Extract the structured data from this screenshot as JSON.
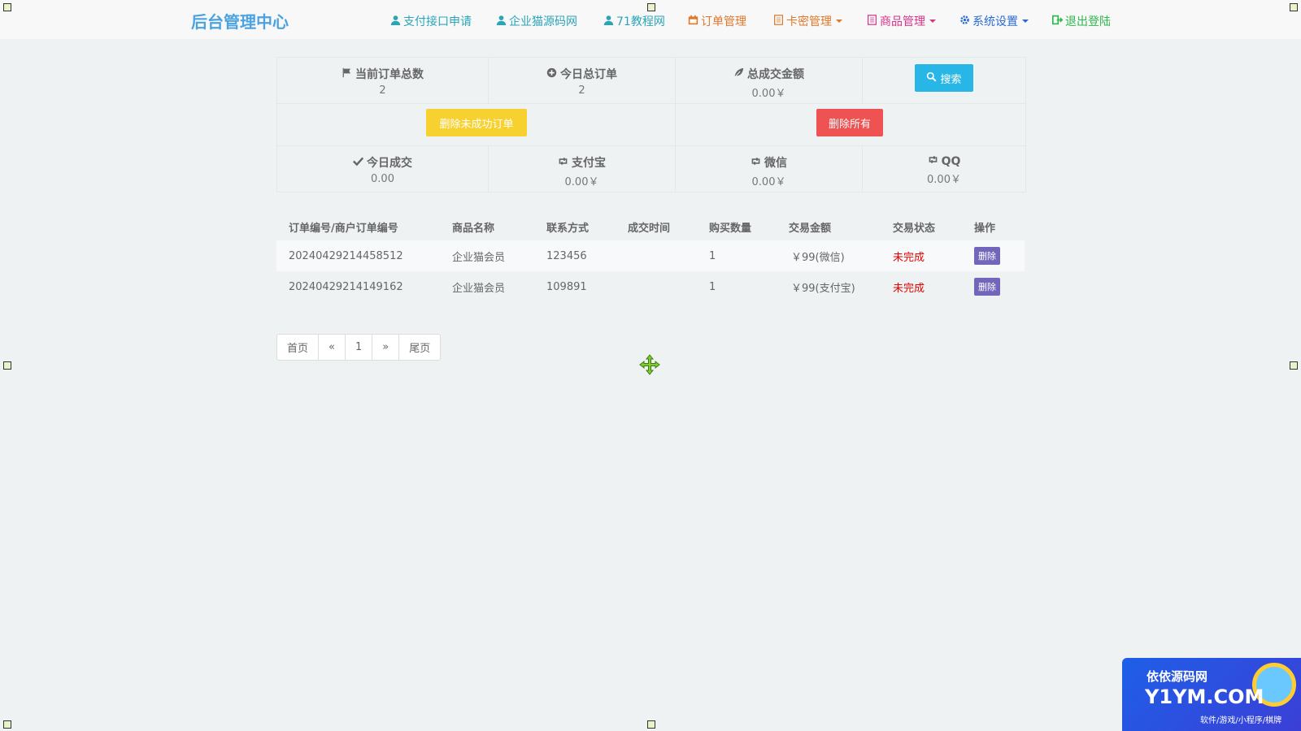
{
  "navbar": {
    "brand": "后台管理中心",
    "items": [
      {
        "label": "支付接口申请",
        "icon": "user-icon",
        "color": "#2aa5b8",
        "dropdown": false
      },
      {
        "label": "企业猫源码网",
        "icon": "user-icon",
        "color": "#2aa5b8",
        "dropdown": false
      },
      {
        "label": "71教程网",
        "icon": "user-icon",
        "color": "#2aa5b8",
        "dropdown": false
      },
      {
        "label": "订单管理",
        "icon": "calendar-icon",
        "color": "#e0782b",
        "dropdown": false
      },
      {
        "label": "卡密管理",
        "icon": "list-icon",
        "color": "#e0782b",
        "dropdown": true
      },
      {
        "label": "商品管理",
        "icon": "list-icon",
        "color": "#d6338a",
        "dropdown": true
      },
      {
        "label": "系统设置",
        "icon": "gear-icon",
        "color": "#2a6bd1",
        "dropdown": true
      },
      {
        "label": "退出登陆",
        "icon": "logout-icon",
        "color": "#2bb84a",
        "dropdown": false
      }
    ]
  },
  "stats": {
    "current_total": {
      "label": "当前订单总数",
      "value": "2",
      "icon": "flag-icon"
    },
    "today_orders": {
      "label": "今日总订单",
      "value": "2",
      "icon": "plus-circle-icon"
    },
    "total_amount": {
      "label": "总成交金额",
      "value": "0.00￥",
      "icon": "leaf-icon"
    },
    "search_button": "搜索",
    "delete_failed_button": "删除未成功订单",
    "delete_all_button": "删除所有",
    "today_deal": {
      "label": "今日成交",
      "value": "0.00",
      "icon": "check-icon"
    },
    "alipay": {
      "label": "支付宝",
      "value": "0.00￥",
      "icon": "retweet-icon"
    },
    "wechat": {
      "label": "微信",
      "value": "0.00￥",
      "icon": "retweet-icon"
    },
    "qq": {
      "label": "QQ",
      "value": "0.00￥",
      "icon": "retweet-icon"
    }
  },
  "table": {
    "headers": [
      "订单编号/商户订单编号",
      "商品名称",
      "联系方式",
      "成交时间",
      "购买数量",
      "交易金额",
      "交易状态",
      "操作"
    ],
    "rows": [
      {
        "order_no": "20240429214458512",
        "product": "企业猫会员",
        "contact": "123456",
        "time": "",
        "qty": "1",
        "amount": "￥99(微信)",
        "status": "未完成",
        "action": "删除"
      },
      {
        "order_no": "20240429214149162",
        "product": "企业猫会员",
        "contact": "109891",
        "time": "",
        "qty": "1",
        "amount": "￥99(支付宝)",
        "status": "未完成",
        "action": "删除"
      }
    ]
  },
  "pagination": [
    "首页",
    "«",
    "1",
    "»",
    "尾页"
  ],
  "watermark": {
    "title": "依依源码网",
    "domain": "Y1YM.COM",
    "subtitle": "软件/游戏/小程序/棋牌"
  }
}
